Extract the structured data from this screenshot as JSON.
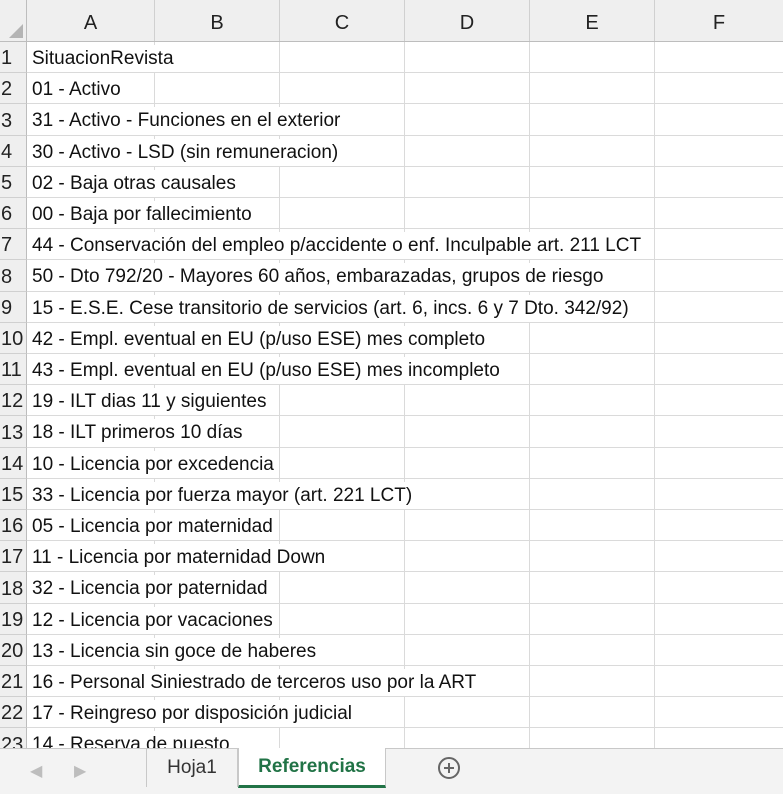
{
  "columns": [
    "A",
    "B",
    "C",
    "D",
    "E",
    "F"
  ],
  "rows": [
    {
      "num": "1",
      "a": "SituacionRevista"
    },
    {
      "num": "2",
      "a": "01 - Activo"
    },
    {
      "num": "3",
      "a": "31 - Activo - Funciones en el exterior"
    },
    {
      "num": "4",
      "a": "30 - Activo - LSD (sin remuneracion)"
    },
    {
      "num": "5",
      "a": "02 - Baja otras causales"
    },
    {
      "num": "6",
      "a": "00 - Baja por fallecimiento"
    },
    {
      "num": "7",
      "a": "44 - Conservación del empleo p/accidente o enf. Inculpable art. 211 LCT"
    },
    {
      "num": "8",
      "a": "50 - Dto 792/20 - Mayores 60 años, embarazadas, grupos de riesgo"
    },
    {
      "num": "9",
      "a": "15 - E.S.E. Cese transitorio de servicios (art. 6, incs. 6 y 7 Dto. 342/92)"
    },
    {
      "num": "10",
      "a": "42 - Empl. eventual en EU (p/uso ESE) mes completo"
    },
    {
      "num": "11",
      "a": "43 - Empl. eventual en EU (p/uso ESE) mes incompleto"
    },
    {
      "num": "12",
      "a": "19 - ILT dias 11 y siguientes"
    },
    {
      "num": "13",
      "a": "18 - ILT primeros 10 días"
    },
    {
      "num": "14",
      "a": "10 - Licencia por excedencia"
    },
    {
      "num": "15",
      "a": "33 - Licencia por fuerza mayor (art. 221 LCT)"
    },
    {
      "num": "16",
      "a": "05 - Licencia por maternidad"
    },
    {
      "num": "17",
      "a": "11 - Licencia por maternidad Down"
    },
    {
      "num": "18",
      "a": "32 - Licencia por paternidad"
    },
    {
      "num": "19",
      "a": "12 - Licencia por vacaciones"
    },
    {
      "num": "20",
      "a": "13 - Licencia sin goce de haberes"
    },
    {
      "num": "21",
      "a": "16 - Personal Siniestrado de terceros uso por la ART"
    },
    {
      "num": "22",
      "a": "17 - Reingreso por disposición judicial"
    },
    {
      "num": "23",
      "a": "14 - Reserva de puesto"
    }
  ],
  "tabs": {
    "sheet1": "Hoja1",
    "sheet2": "Referencias",
    "active": "Referencias"
  },
  "icons": {
    "prev": "chevron-left-icon",
    "next": "chevron-right-icon",
    "add": "plus-circle-icon"
  },
  "colors": {
    "active_tab": "#217346"
  }
}
